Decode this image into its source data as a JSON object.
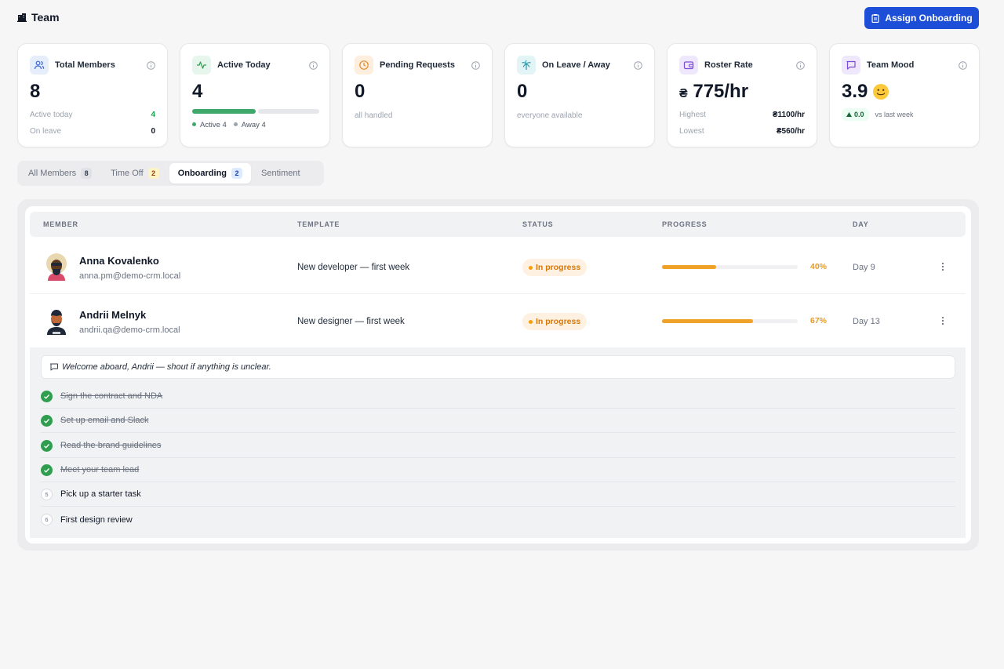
{
  "header": {
    "title": "Team",
    "assign_label": "Assign Onboarding"
  },
  "colors": {
    "primary": "#1d4ed8",
    "green": "#3ea96a",
    "amber": "#f0a12a"
  },
  "cards": [
    {
      "label": "Total Members",
      "icon": "users-icon",
      "value": "8",
      "rows": [
        {
          "label": "Active today",
          "value": "4"
        },
        {
          "label": "On leave",
          "value": "0"
        }
      ]
    },
    {
      "label": "Active Today",
      "icon": "activity-icon",
      "value": "4",
      "progress": 0.5,
      "legend": [
        "Active 4",
        "Away 4"
      ]
    },
    {
      "label": "Pending Requests",
      "icon": "clock-icon",
      "value": "0",
      "sub": "all handled"
    },
    {
      "label": "On Leave / Away",
      "icon": "palm-tree-icon",
      "value": "0",
      "sub": "everyone available"
    },
    {
      "label": "Roster Rate",
      "icon": "wallet-icon",
      "currency": "₴",
      "value": "775/hr",
      "rows": [
        {
          "label": "Highest",
          "value": "₴1100/hr"
        },
        {
          "label": "Lowest",
          "value": "₴560/hr"
        }
      ]
    },
    {
      "label": "Team Mood",
      "icon": "message-icon",
      "value": "3.9",
      "emoji": "🙂",
      "delta": "0.0",
      "delta_text": "vs last week"
    }
  ],
  "tabs": [
    {
      "label": "All Members",
      "count": "8"
    },
    {
      "label": "Time Off",
      "count": "2"
    },
    {
      "label": "Onboarding",
      "count": "2"
    },
    {
      "label": "Sentiment"
    }
  ],
  "table": {
    "columns": [
      "MEMBER",
      "TEMPLATE",
      "STATUS",
      "PROGRESS",
      "DAY"
    ],
    "rows": [
      {
        "name": "Anna Kovalenko",
        "email": "anna.pm@demo-crm.local",
        "template": "New developer — first week",
        "status": "In progress",
        "progress": 40,
        "progress_label": "40%",
        "day": "Day 9"
      },
      {
        "name": "Andrii Melnyk",
        "email": "andrii.qa@demo-crm.local",
        "template": "New designer — first week",
        "status": "In progress",
        "progress": 67,
        "progress_label": "67%",
        "day": "Day 13"
      }
    ]
  },
  "expanded": {
    "note": "Welcome aboard, Andrii — shout if anything is unclear.",
    "tasks": [
      {
        "label": "Sign the contract and NDA",
        "done": true
      },
      {
        "label": "Set up email and Slack",
        "done": true
      },
      {
        "label": "Read the brand guidelines",
        "done": true
      },
      {
        "label": "Meet your team lead",
        "done": true
      },
      {
        "label": "Pick up a starter task",
        "done": false,
        "num": "5"
      },
      {
        "label": "First design review",
        "done": false,
        "num": "6"
      }
    ]
  }
}
